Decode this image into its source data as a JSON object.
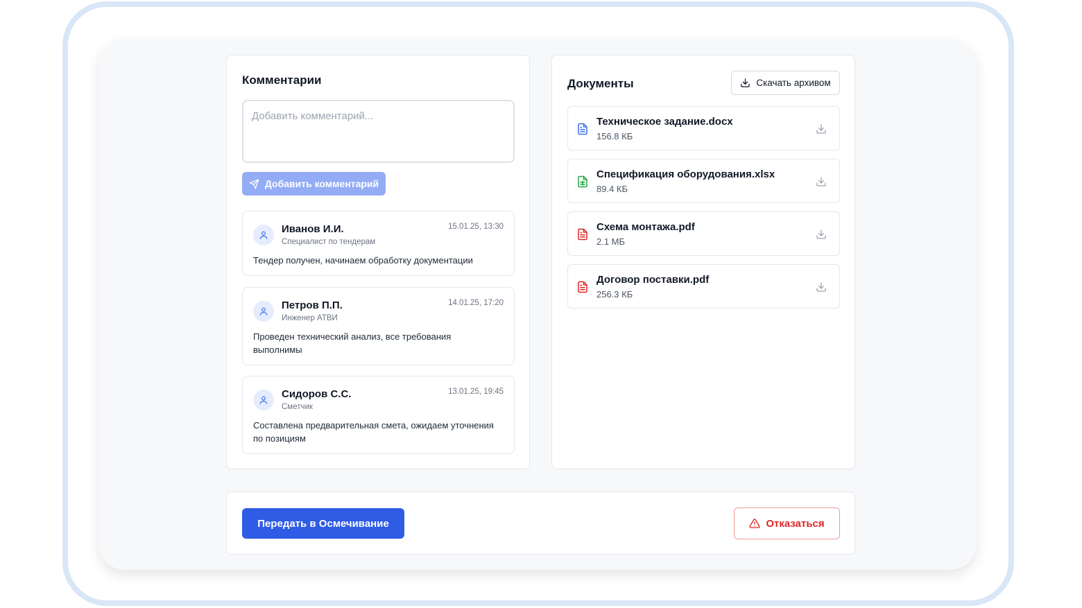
{
  "comments": {
    "title": "Комментарии",
    "input_placeholder": "Добавить комментарий...",
    "add_button_label": "Добавить комментарий",
    "items": [
      {
        "author": "Иванов И.И.",
        "role": "Специалист по тендерам",
        "time": "15.01.25, 13:30",
        "text": "Тендер получен, начинаем обработку документации"
      },
      {
        "author": "Петров П.П.",
        "role": "Инженер АТВИ",
        "time": "14.01.25, 17:20",
        "text": "Проведен технический анализ, все требования выполнимы"
      },
      {
        "author": "Сидоров С.С.",
        "role": "Сметчик",
        "time": "13.01.25, 19:45",
        "text": "Составлена предварительная смета, ожидаем уточнения по позициям"
      }
    ]
  },
  "documents": {
    "title": "Документы",
    "archive_button_label": "Скачать архивом",
    "items": [
      {
        "name": "Техническое задание.docx",
        "size": "156.8 КБ",
        "icon": "file-text-icon",
        "color": "#3b6fe8"
      },
      {
        "name": "Спецификация оборудования.xlsx",
        "size": "89.4 КБ",
        "icon": "file-spreadsheet-icon",
        "color": "#22a447"
      },
      {
        "name": "Схема монтажа.pdf",
        "size": "2.1 МБ",
        "icon": "file-pdf-icon",
        "color": "#dc2626"
      },
      {
        "name": "Договор поставки.pdf",
        "size": "256.3 КБ",
        "icon": "file-pdf-icon",
        "color": "#dc2626"
      }
    ]
  },
  "footer": {
    "primary_label": "Передать в Осмечивание",
    "reject_label": "Отказаться"
  },
  "colors": {
    "primary": "#2f5ce5",
    "primary_disabled": "#93acf5",
    "danger": "#dc2626",
    "frame": "#d9e6f7"
  }
}
